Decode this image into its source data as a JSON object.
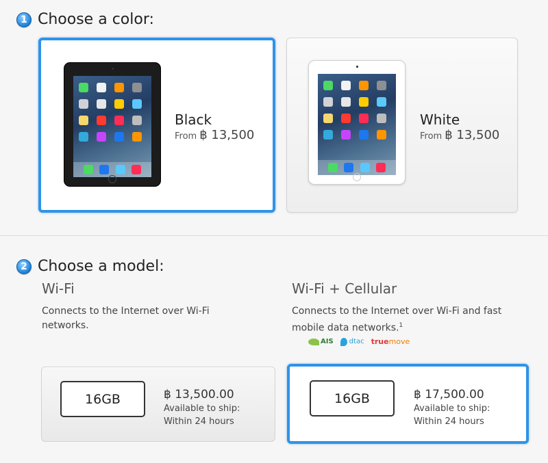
{
  "step1": {
    "number": "1",
    "title": "Choose a color:"
  },
  "colors": [
    {
      "name": "Black",
      "from_label": "From",
      "price": "฿ 13,500",
      "selected": true
    },
    {
      "name": "White",
      "from_label": "From",
      "price": "฿ 13,500",
      "selected": false
    }
  ],
  "step2": {
    "number": "2",
    "title": "Choose a model:"
  },
  "models": [
    {
      "title": "Wi-Fi",
      "description": "Connects to the Internet over Wi-Fi networks.",
      "capacity": "16GB",
      "price": "฿ 13,500.00",
      "ship_label": "Available to ship:",
      "ship_time": "Within 24 hours",
      "selected": false
    },
    {
      "title": "Wi-Fi + Cellular",
      "description": "Connects to the Internet over Wi-Fi and fast mobile data networks.",
      "footnote": "1",
      "capacity": "16GB",
      "price": "฿ 17,500.00",
      "ship_label": "Available to ship:",
      "ship_time": "Within 24 hours",
      "selected": true
    }
  ],
  "carriers": {
    "ais": "AIS",
    "dtac": "dtac",
    "truemove_a": "true",
    "truemove_b": "move"
  },
  "accent_color": "#2f93e8"
}
